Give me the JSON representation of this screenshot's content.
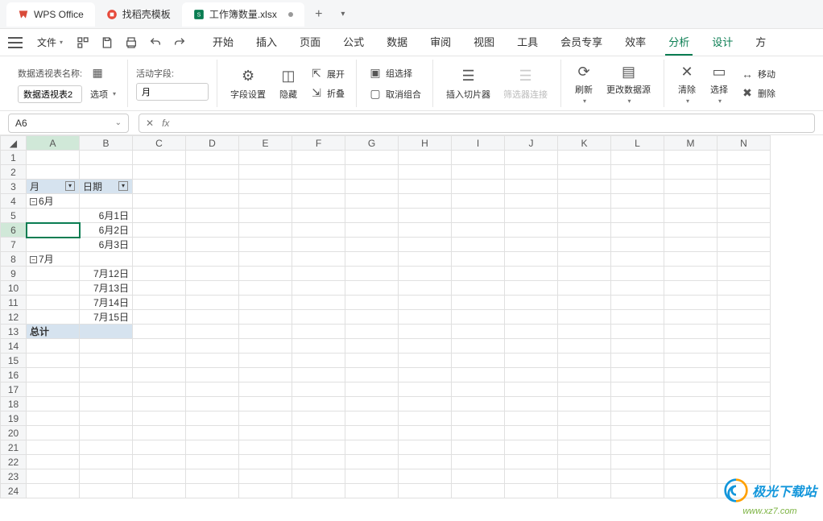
{
  "tabs": {
    "home": "WPS Office",
    "tpl": "找稻壳模板",
    "file": "工作簿数量.xlsx"
  },
  "menu": {
    "file": "文件",
    "items": [
      "开始",
      "插入",
      "页面",
      "公式",
      "数据",
      "审阅",
      "视图",
      "工具",
      "会员专享",
      "效率",
      "分析",
      "设计",
      "方"
    ]
  },
  "ribbon": {
    "pivot_name_label": "数据透视表名称:",
    "pivot_name_value": "数据透视表2",
    "options": "选项",
    "active_field_label": "活动字段:",
    "active_field_value": "月",
    "field_settings": "字段设置",
    "hide": "隐藏",
    "expand": "展开",
    "collapse": "折叠",
    "group_sel": "组选择",
    "ungroup": "取消组合",
    "insert_slicer": "插入切片器",
    "filter_conn": "筛选器连接",
    "refresh": "刷新",
    "change_src": "更改数据源",
    "clear": "清除",
    "select": "选择",
    "move": "移动",
    "delete": "删除"
  },
  "namebox": "A6",
  "fx": "fx",
  "columns": [
    "A",
    "B",
    "C",
    "D",
    "E",
    "F",
    "G",
    "H",
    "I",
    "J",
    "K",
    "L",
    "M",
    "N"
  ],
  "rows": [
    "1",
    "2",
    "3",
    "4",
    "5",
    "6",
    "7",
    "8",
    "9",
    "10",
    "11",
    "12",
    "13",
    "14",
    "15",
    "16",
    "17",
    "18",
    "19",
    "20",
    "21",
    "22",
    "23",
    "24"
  ],
  "grid": {
    "hdr_month": "月",
    "hdr_date": "日期",
    "m6": "6月",
    "m7": "7月",
    "d1": "6月1日",
    "d2": "6月2日",
    "d3": "6月3日",
    "d12": "7月12日",
    "d13": "7月13日",
    "d14": "7月14日",
    "d15": "7月15日",
    "total": "总计"
  },
  "watermark": {
    "main": "极光下载站",
    "sub": "www.xz7.com"
  }
}
